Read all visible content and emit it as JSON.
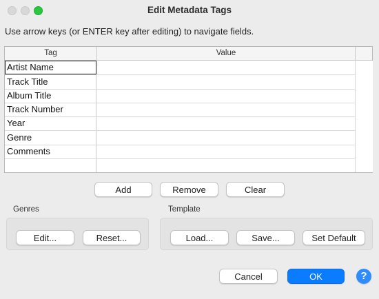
{
  "window": {
    "title": "Edit Metadata Tags"
  },
  "instructions": "Use arrow keys (or ENTER key after editing) to navigate fields.",
  "table": {
    "columns": [
      "Tag",
      "Value"
    ],
    "rows": [
      {
        "tag": "Artist Name",
        "value": ""
      },
      {
        "tag": "Track Title",
        "value": ""
      },
      {
        "tag": "Album Title",
        "value": ""
      },
      {
        "tag": "Track Number",
        "value": ""
      },
      {
        "tag": "Year",
        "value": ""
      },
      {
        "tag": "Genre",
        "value": ""
      },
      {
        "tag": "Comments",
        "value": ""
      },
      {
        "tag": "",
        "value": ""
      }
    ]
  },
  "table_actions": {
    "add": "Add",
    "remove": "Remove",
    "clear": "Clear"
  },
  "genres": {
    "label": "Genres",
    "edit": "Edit...",
    "reset": "Reset..."
  },
  "template": {
    "label": "Template",
    "load": "Load...",
    "save": "Save...",
    "set_default": "Set Default"
  },
  "footer": {
    "cancel": "Cancel",
    "ok": "OK",
    "help": "?"
  },
  "colors": {
    "accent": "#0a7cff",
    "zoom": "#2ac841",
    "help": "#2f8cff"
  }
}
